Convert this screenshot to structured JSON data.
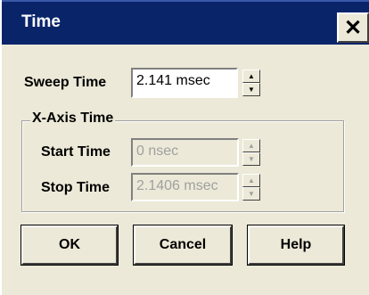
{
  "window": {
    "title": "Time",
    "close_label": "✕"
  },
  "sweep": {
    "label": "Sweep Time",
    "value": "2.141 msec"
  },
  "x_axis": {
    "group_label": "X-Axis Time",
    "start": {
      "label": "Start Time",
      "value": "0 nsec"
    },
    "stop": {
      "label": "Stop Time",
      "value": "2.1406 msec"
    }
  },
  "buttons": {
    "ok": "OK",
    "cancel": "Cancel",
    "help": "Help"
  },
  "spinner": {
    "up": "▲",
    "down": "▼"
  }
}
